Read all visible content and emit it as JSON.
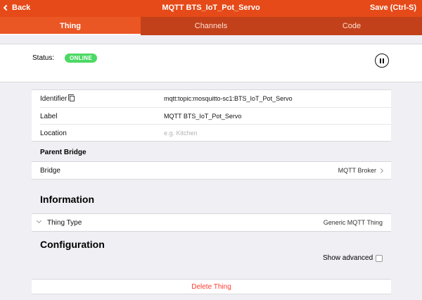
{
  "navbar": {
    "back_label": "Back",
    "title": "MQTT BTS_IoT_Pot_Servo",
    "save_label": "Save (Ctrl-S)"
  },
  "tabs": [
    {
      "label": "Thing",
      "active": true
    },
    {
      "label": "Channels",
      "active": false
    },
    {
      "label": "Code",
      "active": false
    }
  ],
  "status": {
    "label": "Status:",
    "badge": "ONLINE",
    "badge_color": "#4cd964"
  },
  "details": {
    "identifier_label": "Identifier",
    "identifier_value": "mqtt:topic:mosquitto-sc1:BTS_IoT_Pot_Servo",
    "label_label": "Label",
    "label_value": "MQTT BTS_IoT_Pot_Servo",
    "location_label": "Location",
    "location_placeholder": "e.g. Kitchen"
  },
  "parent_bridge": {
    "heading": "Parent Bridge",
    "row_label": "Bridge",
    "row_value": "MQTT Broker"
  },
  "information": {
    "heading": "Information",
    "thing_type_label": "Thing Type",
    "thing_type_value": "Generic MQTT Thing"
  },
  "configuration": {
    "heading": "Configuration",
    "show_advanced_label": "Show advanced"
  },
  "delete_label": "Delete Thing",
  "colors": {
    "accent": "#e64a19",
    "danger": "#ff3b30"
  }
}
